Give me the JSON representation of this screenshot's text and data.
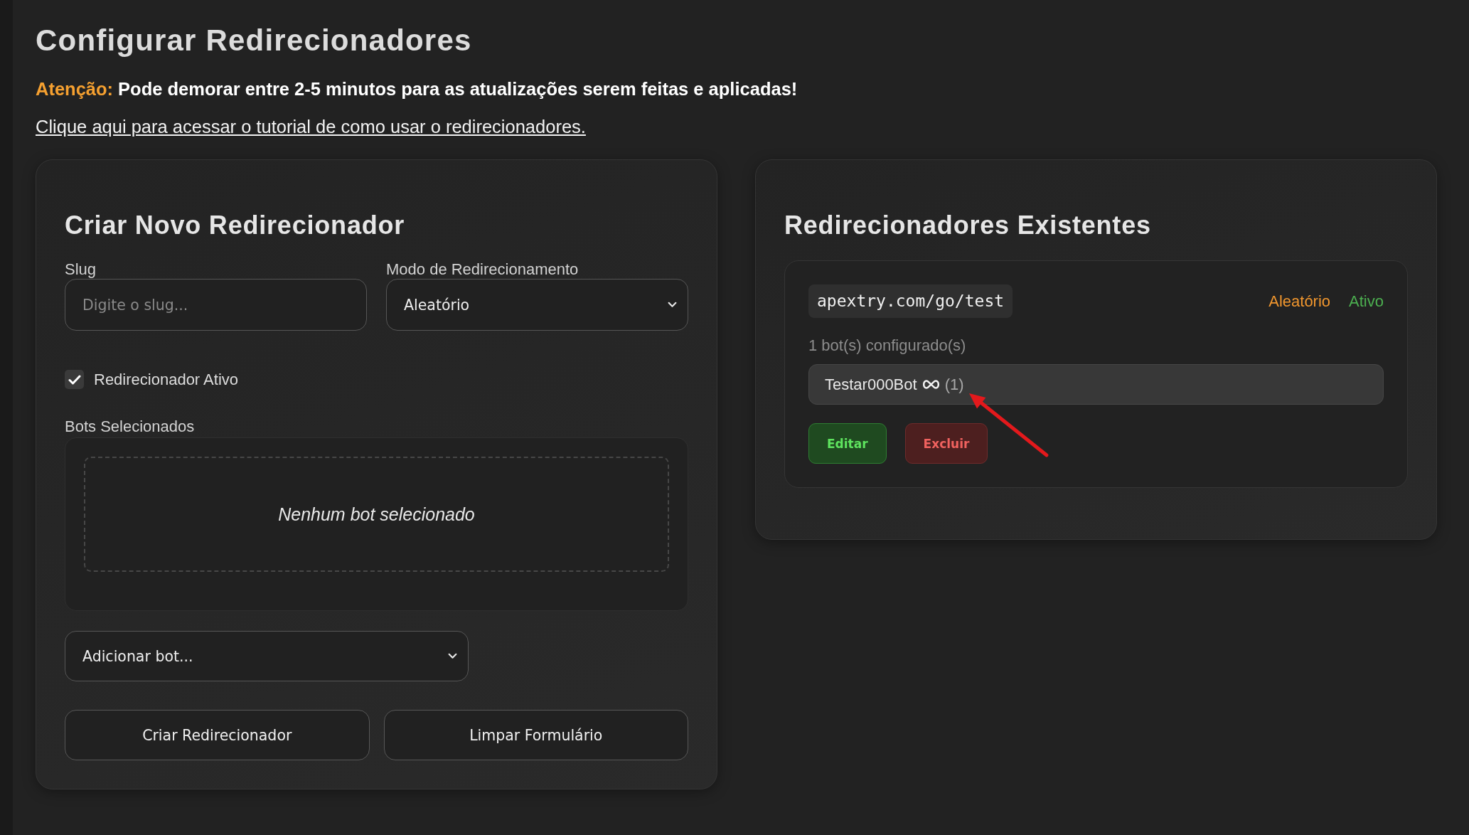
{
  "page": {
    "title": "Configurar Redirecionadores",
    "notice": {
      "label": "Atenção:",
      "text": "Pode demorar entre 2-5 minutos para as atualizações serem feitas e aplicadas!"
    },
    "tutorial_link": "Clique aqui para acessar o tutorial de como usar o redirecionadores."
  },
  "create_panel": {
    "title": "Criar Novo Redirecionador",
    "slug": {
      "label": "Slug",
      "placeholder": "Digite o slug..."
    },
    "mode": {
      "label": "Modo de Redirecionamento",
      "value": "Aleatório"
    },
    "active": {
      "label": "Redirecionador Ativo",
      "checked": true
    },
    "bots": {
      "label": "Bots Selecionados",
      "empty_text": "Nenhum bot selecionado"
    },
    "add_bot": {
      "value": "Adicionar bot..."
    },
    "buttons": [
      "Criar Redirecionador",
      "Limpar Formulário"
    ]
  },
  "list_panel": {
    "title": "Redirecionadores Existentes",
    "redirectors": [
      {
        "url": "apextry.com/go/test",
        "mode": "Aleatório",
        "status": "Ativo",
        "active": true,
        "bot_count": "1 bot(s) configurado(s)",
        "bots": [
          {
            "name": "Testar000Bot",
            "count": "(1)"
          }
        ],
        "actions": [
          {
            "label": "Editar",
            "kind": "edit"
          },
          {
            "label": "Excluir",
            "kind": "delete"
          }
        ]
      }
    ]
  }
}
